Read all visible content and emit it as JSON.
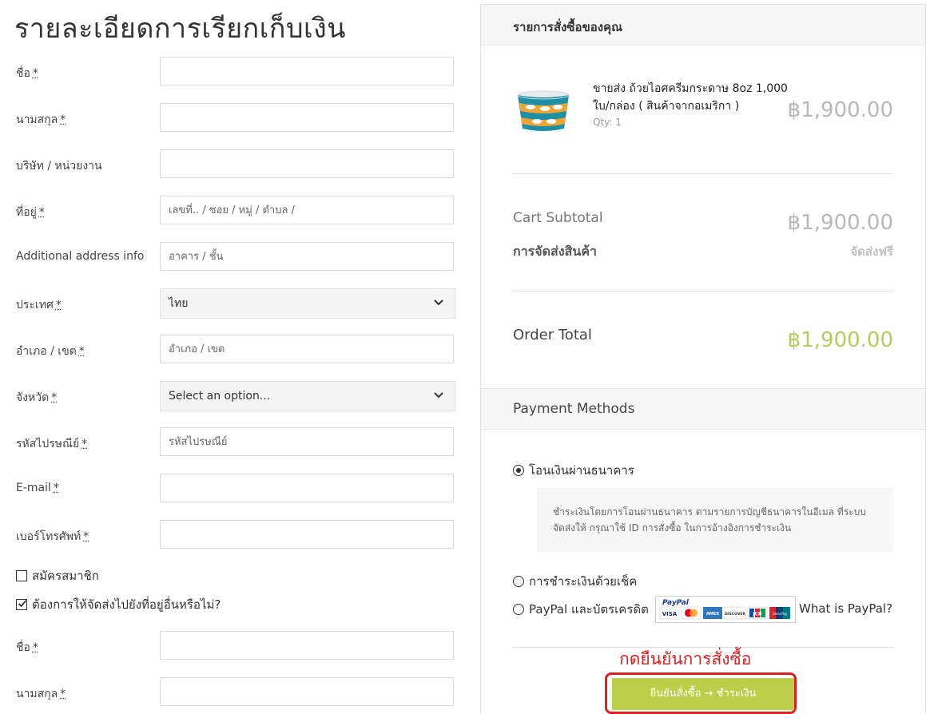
{
  "billing": {
    "title": "รายละเอียดการเรียกเก็บเงิน",
    "required_mark": "*",
    "fields": [
      {
        "label": "ชื่อ",
        "required": true,
        "placeholder": "",
        "type": "text"
      },
      {
        "label": "นามสกุล",
        "required": true,
        "placeholder": "",
        "type": "text"
      },
      {
        "label": "บริษัท / หน่วยงาน",
        "required": false,
        "placeholder": "",
        "type": "text"
      },
      {
        "label": "ที่อยู่",
        "required": true,
        "placeholder": "เลขที่.. / ซอย / หมู่ / ตำบล /",
        "type": "text"
      },
      {
        "label": "Additional address info",
        "required": false,
        "placeholder": "อาคาร / ชั้น",
        "type": "text"
      },
      {
        "label": "ประเทศ",
        "required": true,
        "value": "ไทย",
        "type": "select"
      },
      {
        "label": "อำเภอ / เขต",
        "required": true,
        "placeholder": "อำเภอ / เขต",
        "type": "text"
      },
      {
        "label": "จังหวัด",
        "required": true,
        "value": "Select an option...",
        "type": "select"
      },
      {
        "label": "รหัสไปรษณีย์",
        "required": true,
        "placeholder": "รหัสไปรษณีย์",
        "type": "text"
      },
      {
        "label": "E-mail",
        "required": true,
        "placeholder": "",
        "type": "text"
      },
      {
        "label": "เบอร์โทรศัพท์",
        "required": true,
        "placeholder": "",
        "type": "text"
      }
    ],
    "register_label": "สมัครสมาชิก",
    "register_checked": false,
    "ship_elsewhere_label": "ต้องการให้จัดส่งไปยังที่อยู่อื่นหรือไม่?",
    "ship_elsewhere_checked": true,
    "shipping_fields": [
      {
        "label": "ชื่อ",
        "required": true
      },
      {
        "label": "นามสกุล",
        "required": true
      }
    ]
  },
  "order": {
    "heading": "รายการสั่งซื้อของคุณ",
    "product": {
      "name": "ขายส่ง ถ้วยไอศครีมกระดาษ 8oz 1,000 ใบ/กล่อง ( สินค้าจากอเมริกา )",
      "qty_text": "Qty: 1",
      "price": "฿1,900.00"
    },
    "subtotal_label": "Cart Subtotal",
    "subtotal_value": "฿1,900.00",
    "shipping_label": "การจัดส่งสินค้า",
    "shipping_value": "จัดส่งฟรี",
    "total_label": "Order Total",
    "total_value": "฿1,900.00"
  },
  "payment": {
    "heading": "Payment Methods",
    "methods": [
      {
        "label": "โอนเงินผ่านธนาคาร",
        "selected": true
      },
      {
        "label": "การชำระเงินด้วยเช็ค",
        "selected": false
      },
      {
        "label": "PayPal และบัตรเครดิต",
        "selected": false
      }
    ],
    "bank_desc": "ชำระเงินโดยการโอนผ่านธนาคาร ตามรายการบัญชีธนาคารในอีเมล ที่ระบบจัดส่งให้ กรุณาใช้ ID การสั่งซื้อ ในการอ้างอิงการชำระเงิน",
    "paypal_logo_text": "PayPal",
    "card_logos": [
      "VISA",
      "MasterCard",
      "AMEX",
      "DISCOVER",
      "JCB",
      "UnionPay"
    ],
    "what_is_paypal": "What is PayPal?",
    "annotation": "กดยืนยันการสั่งซื้อ",
    "place_order_label": "ยืนยันสั่งซื้อ → ชำระเงิน"
  },
  "colors": {
    "accent_green": "#bccf48",
    "total_green": "#b6cc5a",
    "annotation_red": "#e02020"
  }
}
